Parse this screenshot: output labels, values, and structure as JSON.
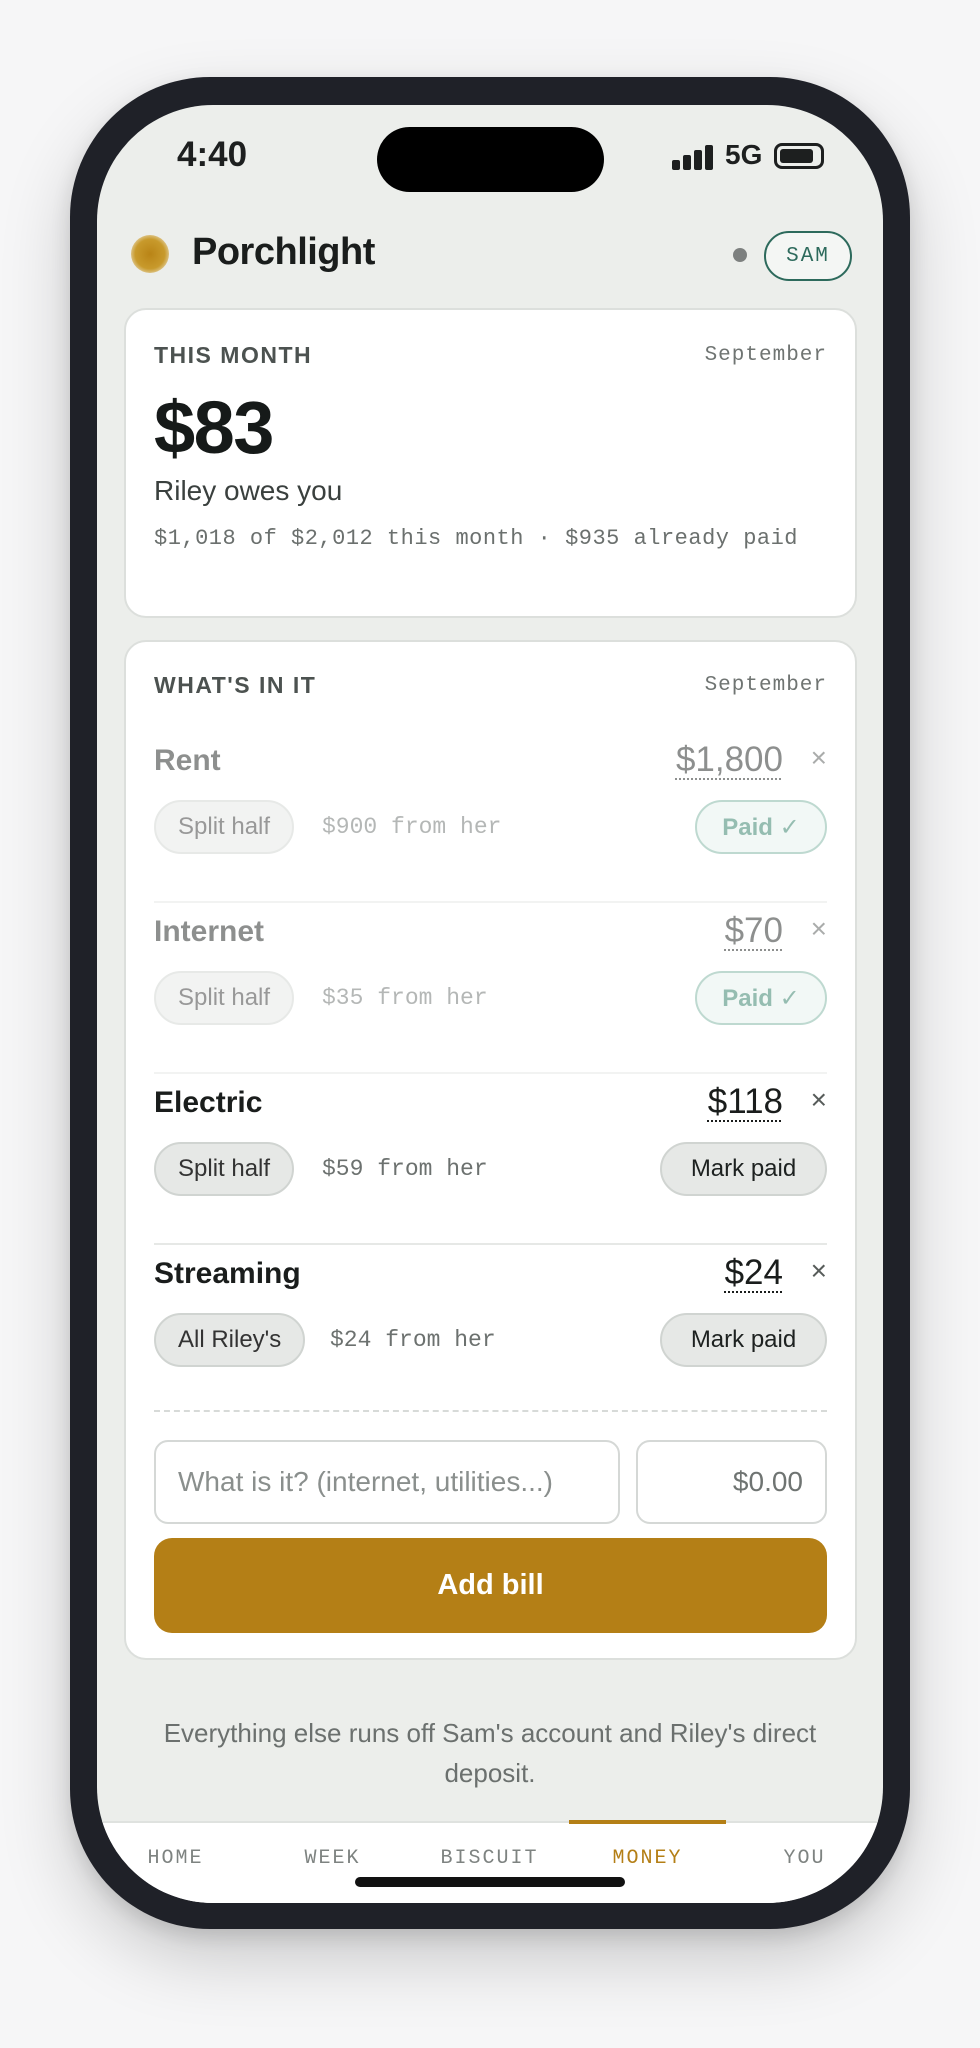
{
  "status_bar": {
    "time": "4:40",
    "network": "5G"
  },
  "header": {
    "app_name": "Porchlight",
    "user_initials": "SAM"
  },
  "summary": {
    "eyebrow": "THIS MONTH",
    "month": "September",
    "amount": "$83",
    "owes_text": "Riley owes you",
    "detail": "$1,018 of $2,012 this month · $935 already paid"
  },
  "items_card": {
    "eyebrow": "WHAT'S IN IT",
    "month": "September",
    "bills": [
      {
        "name": "Rent",
        "amount": "$1,800",
        "split": "Split half",
        "from": "$900 from her",
        "status": "Paid ✓",
        "paid": true
      },
      {
        "name": "Internet",
        "amount": "$70",
        "split": "Split half",
        "from": "$35 from her",
        "status": "Paid ✓",
        "paid": true
      },
      {
        "name": "Electric",
        "amount": "$118",
        "split": "Split half",
        "from": "$59 from her",
        "status": "Mark paid",
        "paid": false
      },
      {
        "name": "Streaming",
        "amount": "$24",
        "split": "All Riley's",
        "from": "$24 from her",
        "status": "Mark paid",
        "paid": false
      }
    ],
    "remove_symbol": "×",
    "name_placeholder": "What is it? (internet, utilities...)",
    "amount_placeholder": "$0.00",
    "add_button": "Add bill"
  },
  "footer_note": "Everything else runs off Sam's account and Riley's direct deposit.",
  "tabs": [
    {
      "label": "HOME",
      "active": false
    },
    {
      "label": "WEEK",
      "active": false
    },
    {
      "label": "BISCUIT",
      "active": false
    },
    {
      "label": "MONEY",
      "active": true
    },
    {
      "label": "YOU",
      "active": false
    }
  ],
  "colors": {
    "accent": "#b47f16",
    "green": "#2d6a5c",
    "paid_green": "#2e7d65"
  }
}
